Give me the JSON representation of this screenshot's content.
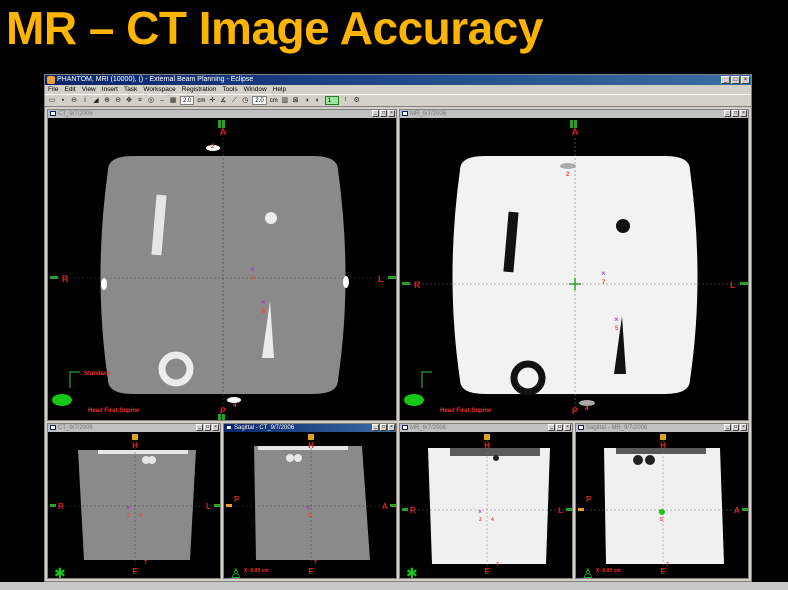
{
  "slide": {
    "title": "MR – CT Image Accuracy"
  },
  "app": {
    "window_title": "PHANTOM, MRI (10000), () - External Beam Planning - Eclipse",
    "menu": [
      "File",
      "Edit",
      "View",
      "Insert",
      "Task",
      "Workspace",
      "Registration",
      "Tools",
      "Window",
      "Help"
    ],
    "toolbar": {
      "thickness_value_1": "2.0",
      "unit_1": "cm",
      "thickness_value_2": "2.0",
      "unit_2": "cm",
      "field_value": "1"
    }
  },
  "views": {
    "ct_transverse": {
      "title": "CT_9/7/2006",
      "labels": {
        "anterior": "A",
        "posterior": "P",
        "right": "R",
        "left": "L"
      },
      "standard_label": "Standard",
      "orientation_label": "Head First-Supine",
      "markers": [
        "7",
        "5",
        "2",
        "4"
      ]
    },
    "mr_transverse": {
      "title": "MR_9/7/2006",
      "labels": {
        "anterior": "A",
        "posterior": "P",
        "right": "R",
        "left": "L"
      },
      "orientation_label": "Head First-Supine",
      "markers": [
        "7",
        "5",
        "2",
        "4"
      ]
    },
    "ct_frontal": {
      "title": "CT_9/7/2006",
      "labels": {
        "head": "H",
        "foot": "F",
        "right": "R",
        "left": "L"
      },
      "markers": [
        "2",
        "4",
        "7"
      ]
    },
    "ct_sagittal": {
      "title": "Sagittal - CT_9/7/2006",
      "labels": {
        "head": "H",
        "foot": "F",
        "posterior": "P",
        "anterior": "A"
      },
      "coord": "X: 0.03 cm",
      "markers": [
        "5",
        "7"
      ]
    },
    "mr_frontal": {
      "title": "MR_9/7/2006",
      "labels": {
        "head": "H",
        "foot": "F",
        "right": "R",
        "left": "L"
      },
      "markers": [
        "2",
        "4",
        "7"
      ]
    },
    "mr_sagittal": {
      "title": "Sagittal - MR_9/7/2006",
      "labels": {
        "head": "H",
        "foot": "F",
        "posterior": "P",
        "anterior": "A"
      },
      "coord": "X: 0.00 cm",
      "markers": [
        "5",
        "7"
      ]
    }
  }
}
